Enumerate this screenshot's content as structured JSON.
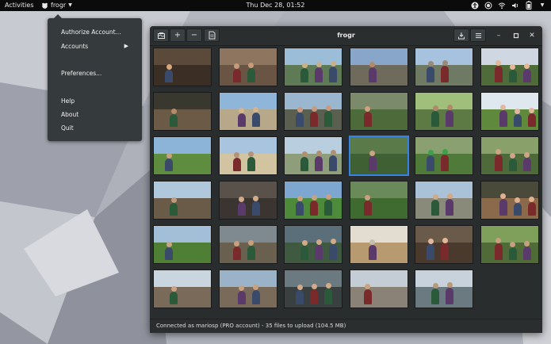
{
  "topbar": {
    "activities": "Activities",
    "app_name": "frogr",
    "clock": "Thu Dec 28, 01:52",
    "tray_icons": [
      "accessibility-icon",
      "record-icon",
      "wifi-icon",
      "volume-icon",
      "battery-icon",
      "power-chevron-icon"
    ]
  },
  "menu": {
    "authorize": "Authorize Account...",
    "accounts": "Accounts",
    "preferences": "Preferences...",
    "help": "Help",
    "about": "About",
    "quit": "Quit"
  },
  "window": {
    "title": "frogr",
    "toolbar_icons": [
      "open-pictures-icon",
      "add-icon",
      "remove-icon",
      "details-icon"
    ],
    "right_icons": [
      "upload-icon",
      "hamburger-menu-icon"
    ],
    "controls": [
      "minimize-icon",
      "maximize-icon",
      "close-icon"
    ],
    "status": "Connected as mariosp (PRO account) - 35 files to upload (104.5 MB)"
  },
  "photos": {
    "count": 35,
    "columns": 6,
    "selected_index": 15,
    "palettes": [
      [
        "#5b4a3a",
        "#3b2e24",
        "#d8a878"
      ],
      [
        "#8d7560",
        "#6a5544",
        "#c99a78"
      ],
      [
        "#9cbdd8",
        "#5f7b55",
        "#c8b08a"
      ],
      [
        "#87a6c9",
        "#6e6a5c",
        "#b08a6a"
      ],
      [
        "#a7c2de",
        "#6f7a64",
        "#9a8a78"
      ],
      [
        "#cfd8e2",
        "#4f6b3a",
        "#e6b89a"
      ],
      [
        "#39382f",
        "#6b5a45",
        "#b78a6b"
      ],
      [
        "#8fb5d9",
        "#b8a88a",
        "#d3b48d"
      ],
      [
        "#9bb6cf",
        "#5a5f50",
        "#c99a80"
      ],
      [
        "#7a8a6a",
        "#4d6a3a",
        "#d0a080"
      ],
      [
        "#9fbf7a",
        "#5d7a45",
        "#b08a6a"
      ],
      [
        "#dfe8ef",
        "#5f8a3c",
        "#e3b7a0"
      ],
      [
        "#8bb4d8",
        "#5e8d3f",
        "#c8a27f"
      ],
      [
        "#a9c4de",
        "#d2c4a0",
        "#b5927a"
      ],
      [
        "#b9cfe0",
        "#8e9d7a",
        "#b09070"
      ],
      [
        "#5a7a4a",
        "#3f5f35",
        "#c9a487"
      ],
      [
        "#8aa070",
        "#4f7a3a",
        "#3fa04a"
      ],
      [
        "#8aa06a",
        "#4e6a3a",
        "#cfa587"
      ],
      [
        "#b0c8dc",
        "#6a5a48",
        "#c09a7a"
      ],
      [
        "#5a524a",
        "#3a3530",
        "#d2ac8a"
      ],
      [
        "#7da7d0",
        "#4d8a3a",
        "#c9a080"
      ],
      [
        "#6a8a5a",
        "#3f6a30",
        "#c8a080"
      ],
      [
        "#a9c2d8",
        "#8a8a7a",
        "#d0a88a"
      ],
      [
        "#4a4a3a",
        "#8a6a4a",
        "#e0b090"
      ],
      [
        "#a3bfd8",
        "#4f7f35",
        "#c8a484"
      ],
      [
        "#7f8a90",
        "#6a6050",
        "#c9a07a"
      ],
      [
        "#5a6f7a",
        "#3f5a40",
        "#d2aa88"
      ],
      [
        "#e3dcd0",
        "#b89a70",
        "#c4c0b4"
      ],
      [
        "#6a5a4a",
        "#4a3a2e",
        "#e3b89a"
      ],
      [
        "#7fa05a",
        "#506a38",
        "#c8a080"
      ],
      [
        "#c9d6e0",
        "#7a6a5a",
        "#d0a080"
      ],
      [
        "#9ab3c9",
        "#7a6a5a",
        "#c8a080"
      ],
      [
        "#6a7a80",
        "#3a3f40",
        "#d2aa88"
      ],
      [
        "#c4cdd5",
        "#8a8276",
        "#c8a484"
      ],
      [
        "#c7d2dc",
        "#6a7a80",
        "#b89a7a"
      ]
    ]
  }
}
